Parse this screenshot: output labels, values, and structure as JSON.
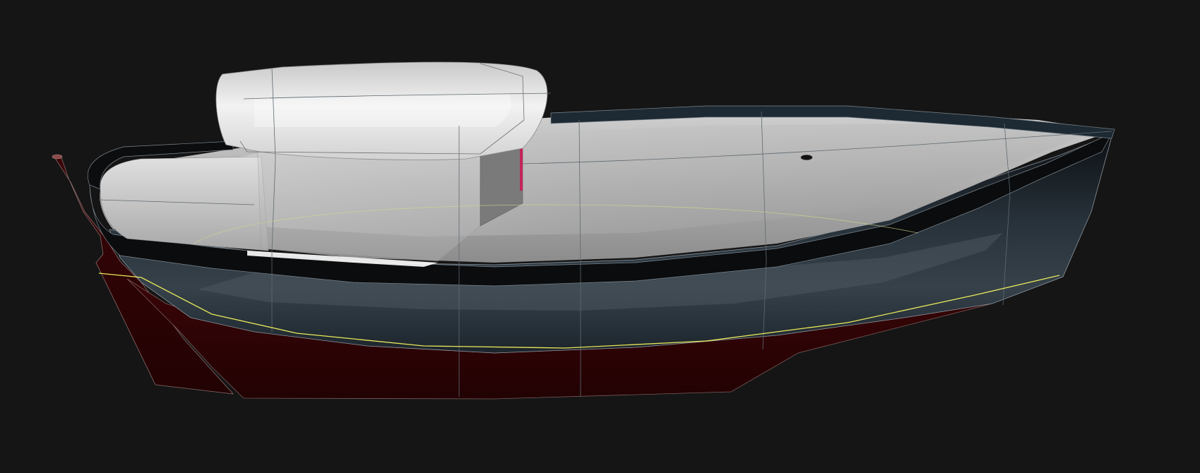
{
  "scene": {
    "subject": "boat-hull-3d-render",
    "colors": {
      "background": "#151515",
      "hull": "#17202a",
      "hull_highlight": "#3a444c",
      "sheer_band": "#0a0c0e",
      "antifouling": "#2b0204",
      "deck": "#bdbdbd",
      "cabin": "#dcdcdc",
      "cabin_side": "#777777",
      "waterline": "#e8e85a",
      "edge_lines": "#b0b0b0",
      "accent_pink": "#c4235a"
    }
  }
}
